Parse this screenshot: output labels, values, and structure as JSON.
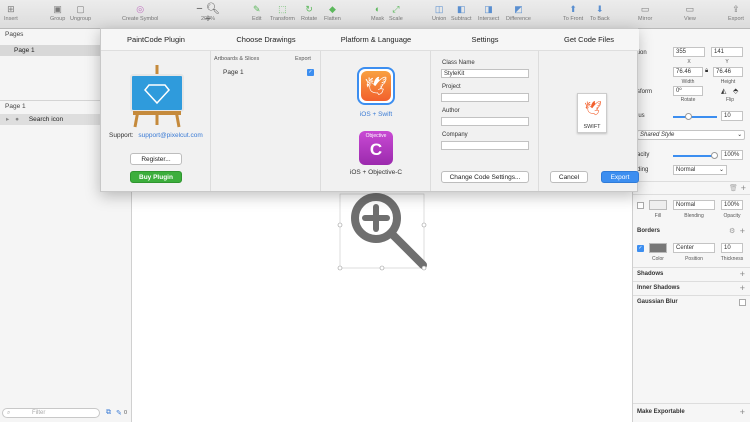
{
  "toolbar": {
    "insert": "Insert",
    "group": "Group",
    "ungroup": "Ungroup",
    "create_symbol": "Create Symbol",
    "zoom_minus": "−",
    "zoom": "200%",
    "zoom_plus": "+",
    "edit": "Edit",
    "transform": "Transform",
    "rotate": "Rotate",
    "flatten": "Flatten",
    "mask": "Mask",
    "scale": "Scale",
    "union": "Union",
    "subtract": "Subtract",
    "intersect": "Intersect",
    "difference": "Difference",
    "to_front": "To Front",
    "to_back": "To Back",
    "mirror": "Mirror",
    "view": "View",
    "export": "Export"
  },
  "sidebar": {
    "pages_header": "Pages",
    "page_item": "Page 1",
    "layer_page": "Page 1",
    "layer_item": "Search icon",
    "filter_placeholder": "Filter",
    "layer_count": "0"
  },
  "inspector": {
    "position_label": "tion",
    "x": "355",
    "y": "141",
    "x_label": "X",
    "y_label": "Y",
    "width": "76.46",
    "height": "76.46",
    "width_label": "Width",
    "height_label": "Height",
    "transform_label": "sform",
    "rotate": "0º",
    "rotate_label": "Rotate",
    "flip_label": "Flip",
    "radius_label": "ius",
    "radius": "10",
    "style": "Shared Style",
    "opacity_label": "acity",
    "opacity": "100%",
    "blend_label": "ding",
    "blend": "Normal",
    "fill_blend": "Normal",
    "fill_opacity": "100%",
    "fill_label": "Fill",
    "fill_blend_label": "Blending",
    "fill_opacity_label": "Opacity",
    "borders": "Borders",
    "border_pos": "Center",
    "border_thick": "10",
    "color_label": "Color",
    "position_sub": "Position",
    "thickness_label": "Thickness",
    "shadows": "Shadows",
    "inner_shadows": "Inner Shadows",
    "gaussian": "Gaussian Blur",
    "make_exportable": "Make Exportable"
  },
  "modal": {
    "steps": [
      "PaintCode Plugin",
      "Choose Drawings",
      "Platform & Language",
      "Settings",
      "Get Code Files"
    ],
    "support_label": "Support:",
    "support_email": "support@pixelcut.com",
    "register": "Register...",
    "buy": "Buy Plugin",
    "artboards_header": "Artboards & Slices",
    "export_header": "Export",
    "drawing_item": "Page 1",
    "ios_swift": "iOS + Swift",
    "ios_objc": "iOS + Objective-C",
    "objc_badge": "Objective",
    "objc_letter": "C",
    "class_name_label": "Class Name",
    "class_name": "StyleKit",
    "project_label": "Project",
    "author_label": "Author",
    "company_label": "Company",
    "change_settings": "Change Code Settings...",
    "file_label": "SWIFT",
    "cancel": "Cancel",
    "export": "Export"
  },
  "colors": {
    "accent": "#3c8ef0",
    "buy": "#3cae3c",
    "swift": "#f2602d",
    "objc": "#b73cc0",
    "link": "#3a7bd5"
  }
}
